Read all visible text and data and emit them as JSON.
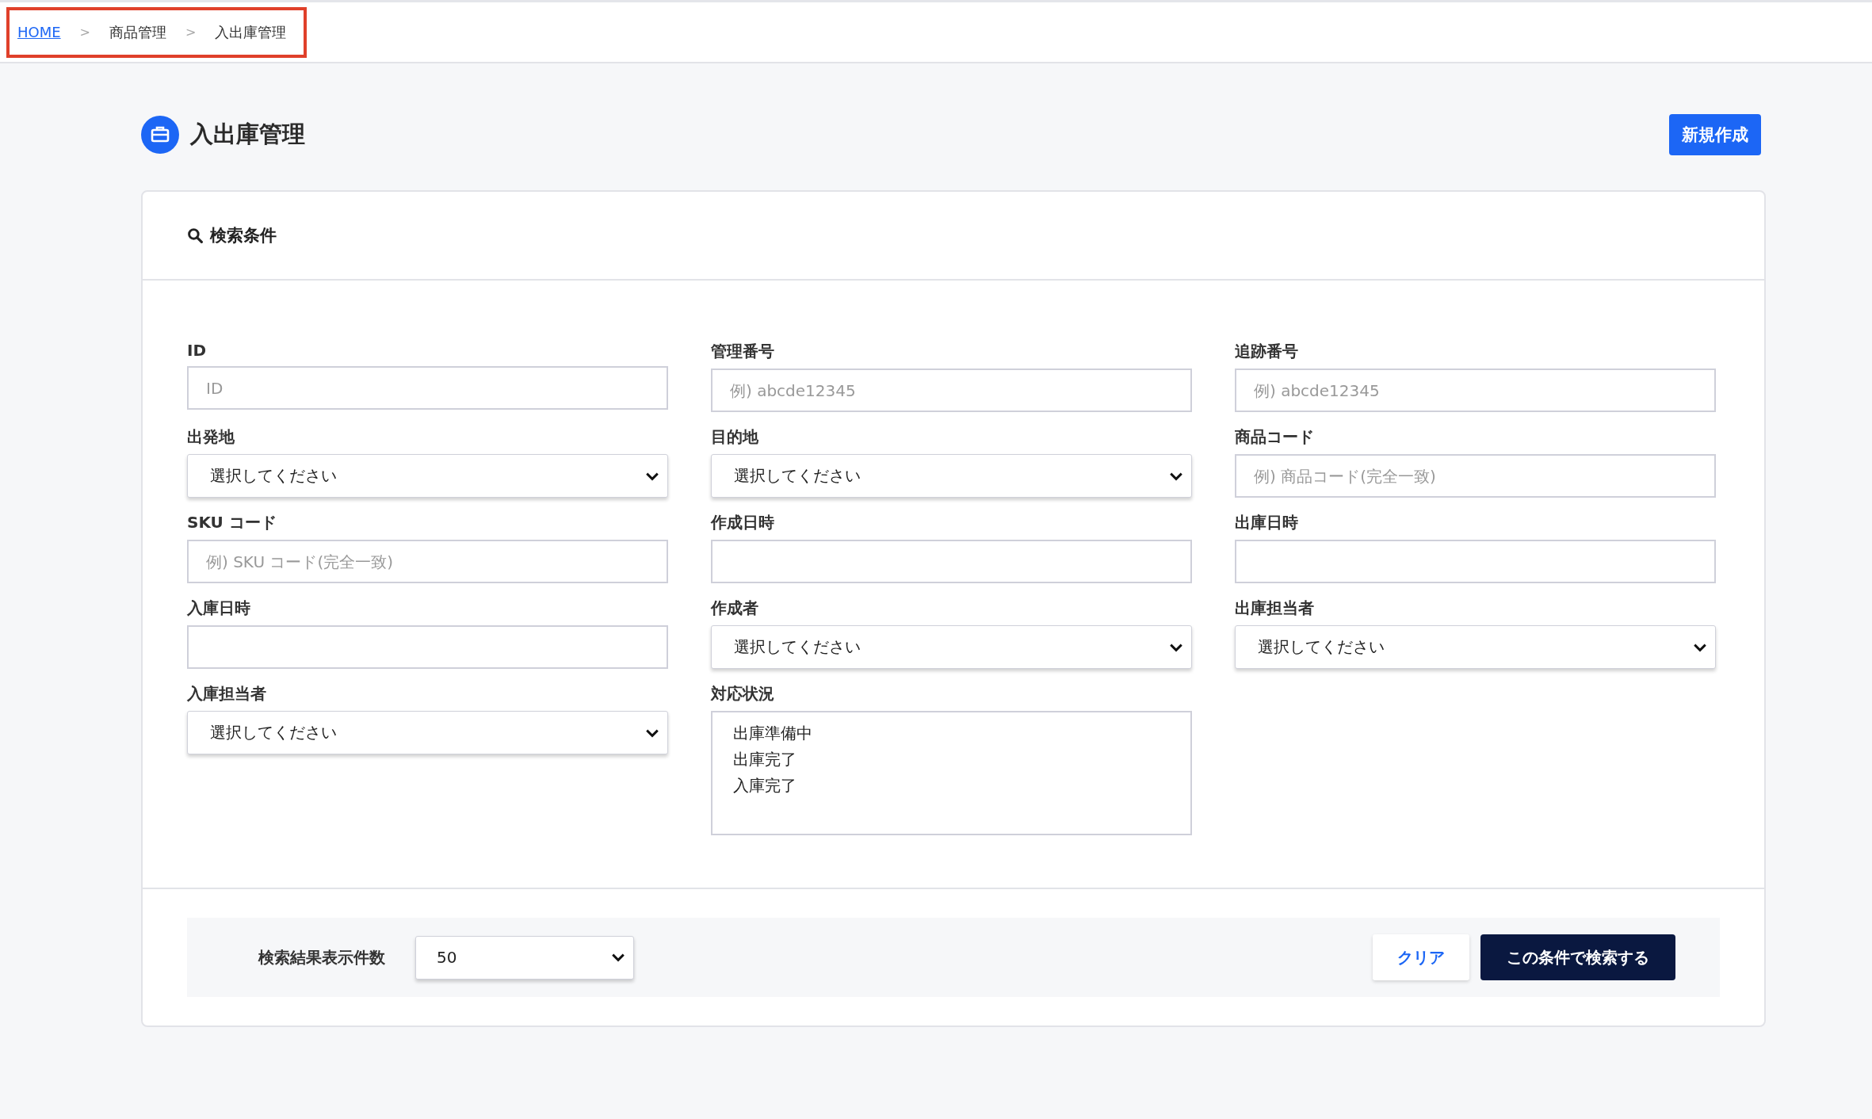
{
  "breadcrumb": [
    {
      "kind": "link",
      "label": "HOME"
    },
    {
      "kind": "separator",
      "label": ">"
    },
    {
      "kind": "text",
      "label": "商品管理"
    },
    {
      "kind": "separator",
      "label": ">"
    },
    {
      "kind": "text",
      "label": "入出庫管理"
    }
  ],
  "page": {
    "title": "入出庫管理",
    "new_button": "新規作成"
  },
  "search_panel": {
    "title": "検索条件",
    "fields": [
      {
        "label": "ID",
        "kind": "text",
        "placeholder": "ID"
      },
      {
        "label": "管理番号",
        "kind": "text",
        "placeholder": "例) abcde12345"
      },
      {
        "label": "追跡番号",
        "kind": "text",
        "placeholder": "例) abcde12345"
      },
      {
        "label": "出発地",
        "kind": "select",
        "value": "選択してください"
      },
      {
        "label": "目的地",
        "kind": "select",
        "value": "選択してください"
      },
      {
        "label": "商品コード",
        "kind": "text",
        "placeholder": "例) 商品コード(完全一致)"
      },
      {
        "label": "SKU コード",
        "kind": "text",
        "placeholder": "例) SKU コード(完全一致)"
      },
      {
        "label": "作成日時",
        "kind": "date"
      },
      {
        "label": "出庫日時",
        "kind": "date"
      },
      {
        "label": "入庫日時",
        "kind": "date"
      },
      {
        "label": "作成者",
        "kind": "select",
        "value": "選択してください"
      },
      {
        "label": "出庫担当者",
        "kind": "select",
        "value": "選択してください"
      },
      {
        "label": "入庫担当者",
        "kind": "select",
        "value": "選択してください"
      },
      {
        "label": "対応状況",
        "kind": "listbox",
        "options": [
          {
            "label": "出庫準備中",
            "selected": false
          },
          {
            "label": "出庫完了",
            "selected": false
          },
          {
            "label": "入庫完了",
            "selected": false
          }
        ]
      }
    ],
    "results_per_page": {
      "label": "検索結果表示件数",
      "value": "50"
    },
    "buttons": [
      {
        "label": "クリア",
        "kind": "secondary"
      },
      {
        "label": "この条件で検索する",
        "kind": "primary"
      }
    ]
  }
}
